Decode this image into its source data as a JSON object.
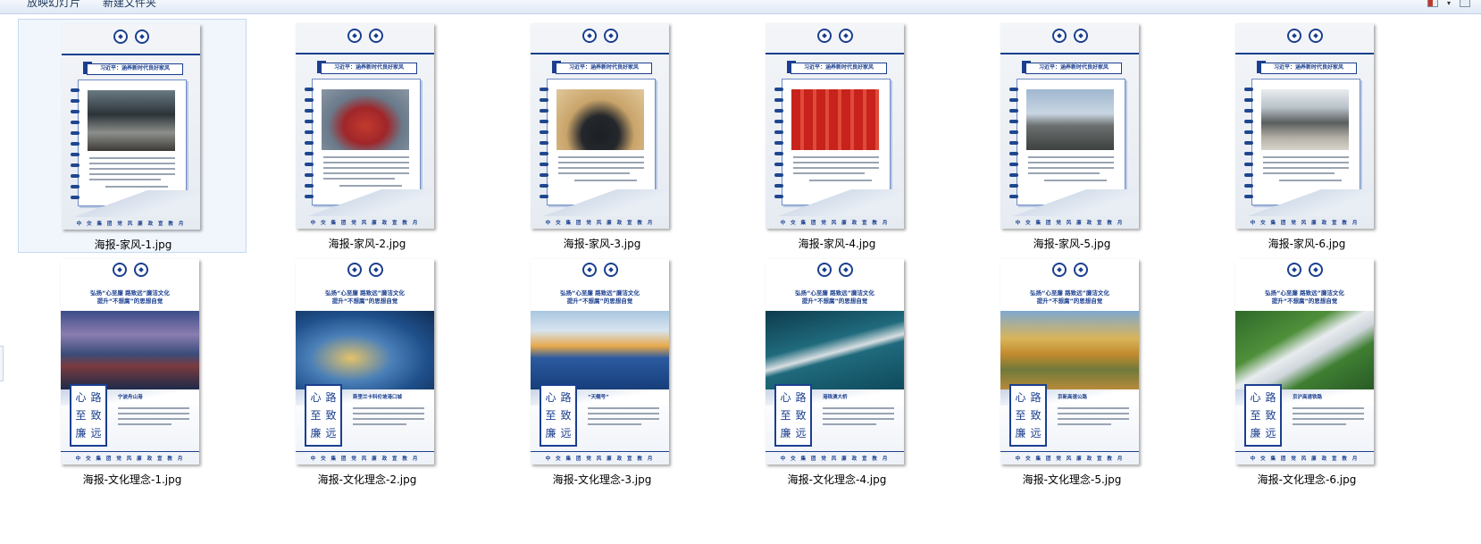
{
  "toolbar": {
    "slideshow_label": "放映幻灯片",
    "new_folder_label": "新建文件夹"
  },
  "poster_text": {
    "family_banner": "习近平：涵养新时代良好家风",
    "culture_title_line1": "弘扬“心至廉 路致远”廉洁文化",
    "culture_title_line2": "提升“不想腐”的思想自觉",
    "calligraphy": [
      "心",
      "路",
      "至",
      "致",
      "廉",
      "远"
    ],
    "footer": "中 交 集 团 党 风 廉 政 宣 教 月"
  },
  "files": {
    "row1": [
      {
        "name": "海报-家风-1.jpg",
        "selected": true
      },
      {
        "name": "海报-家风-2.jpg",
        "selected": false
      },
      {
        "name": "海报-家风-3.jpg",
        "selected": false
      },
      {
        "name": "海报-家风-4.jpg",
        "selected": false
      },
      {
        "name": "海报-家风-5.jpg",
        "selected": false
      },
      {
        "name": "海报-家风-6.jpg",
        "selected": false
      }
    ],
    "row2": [
      {
        "name": "海报-文化理念-1.jpg",
        "caption": "宁波舟山港"
      },
      {
        "name": "海报-文化理念-2.jpg",
        "caption": "斯里兰卡科伦坡港口城"
      },
      {
        "name": "海报-文化理念-3.jpg",
        "caption": "“天鲲号”"
      },
      {
        "name": "海报-文化理念-4.jpg",
        "caption": "港珠澳大桥"
      },
      {
        "name": "海报-文化理念-5.jpg",
        "caption": "京新高速公路"
      },
      {
        "name": "海报-文化理念-6.jpg",
        "caption": "京沪高速铁路"
      }
    ]
  },
  "colors": {
    "poster_blue": "#1b3f8f",
    "selection_bg": "#f1f6fd",
    "selection_border": "#c4d9f3"
  }
}
